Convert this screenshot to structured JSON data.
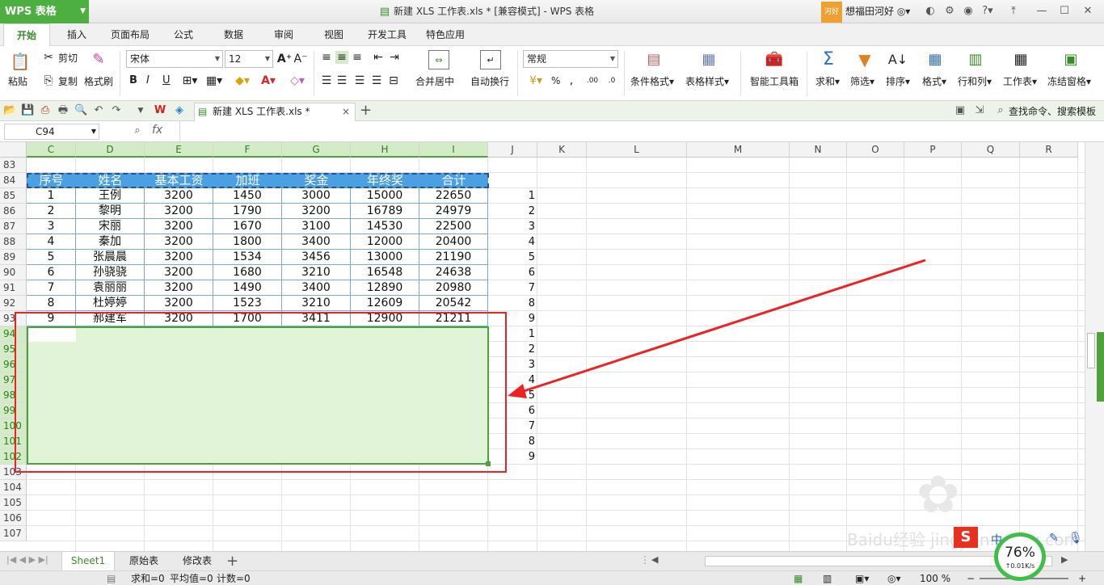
{
  "app": {
    "name": "WPS 表格",
    "window_title": "新建 XLS 工作表.xls * [兼容模式] - WPS 表格",
    "user_badge": "河好",
    "user_name": "想福田河好"
  },
  "ribbon_tabs": [
    "开始",
    "插入",
    "页面布局",
    "公式",
    "数据",
    "审阅",
    "视图",
    "开发工具",
    "特色应用"
  ],
  "ribbon": {
    "paste": "粘贴",
    "cut": "剪切",
    "copy": "复制",
    "format_painter": "格式刷",
    "font_name": "宋体",
    "font_size": "12",
    "bold": "B",
    "italic": "I",
    "underline": "U",
    "merge_center": "合并居中",
    "wrap_text": "自动换行",
    "number_format": "常规",
    "percent": "%",
    "cond_format": "条件格式",
    "table_style": "表格样式",
    "smart_toolbox": "智能工具箱",
    "sum": "求和",
    "filter": "筛选",
    "sort": "排序",
    "format": "格式",
    "row_col": "行和列",
    "worksheet": "工作表",
    "freeze": "冻结窗格"
  },
  "doc_tab": {
    "title": "新建 XLS 工作表.xls *",
    "close": "×",
    "add": "+"
  },
  "search_cmd": "查找命令、搜索模板",
  "name_box": "C94",
  "fx": "fx",
  "columns": [
    "C",
    "D",
    "E",
    "F",
    "G",
    "H",
    "I",
    "J",
    "K",
    "L",
    "M",
    "N",
    "O",
    "P",
    "Q",
    "R"
  ],
  "rows": [
    "83",
    "84",
    "85",
    "86",
    "87",
    "88",
    "89",
    "90",
    "91",
    "92",
    "93",
    "94",
    "95",
    "96",
    "97",
    "98",
    "99",
    "100",
    "101",
    "102",
    "103",
    "104",
    "105",
    "106",
    "107"
  ],
  "table": {
    "headers": [
      "序号",
      "姓名",
      "基本工资",
      "加班",
      "奖金",
      "年终奖",
      "合计"
    ],
    "rows": [
      [
        "1",
        "王例",
        "3200",
        "1450",
        "3000",
        "15000",
        "22650"
      ],
      [
        "2",
        "黎明",
        "3200",
        "1790",
        "3200",
        "16789",
        "24979"
      ],
      [
        "3",
        "宋丽",
        "3200",
        "1670",
        "3100",
        "14530",
        "22500"
      ],
      [
        "4",
        "秦加",
        "3200",
        "1800",
        "3400",
        "12000",
        "20400"
      ],
      [
        "5",
        "张晨晨",
        "3200",
        "1534",
        "3456",
        "13000",
        "21190"
      ],
      [
        "6",
        "孙骁骁",
        "3200",
        "1680",
        "3210",
        "16548",
        "24638"
      ],
      [
        "7",
        "袁丽丽",
        "3200",
        "1490",
        "3400",
        "12890",
        "20980"
      ],
      [
        "8",
        "杜婷婷",
        "3200",
        "1523",
        "3210",
        "12609",
        "20542"
      ],
      [
        "9",
        "郝建军",
        "3200",
        "1700",
        "3411",
        "12900",
        "21211"
      ]
    ]
  },
  "col_j_values": [
    "1",
    "2",
    "3",
    "4",
    "5",
    "6",
    "7",
    "8",
    "9",
    "1",
    "2",
    "3",
    "4",
    "5",
    "6",
    "7",
    "8",
    "9"
  ],
  "sheet_tabs": [
    "Sheet1",
    "原始表",
    "修改表"
  ],
  "add_sheet": "+",
  "status": {
    "sum": "求和=0",
    "avg": "平均值=0",
    "count": "计数=0",
    "zoom": "100 %"
  },
  "speed": {
    "percent": "76%",
    "rate": "↑0.01K/s"
  },
  "watermark": "Baidu经验 jingyan.baidu.com",
  "colors": {
    "accent": "#4caf3f",
    "header_fill": "#4aa0e3",
    "selection_fill": "#e2f4d7",
    "annotation": "#ee2222"
  }
}
